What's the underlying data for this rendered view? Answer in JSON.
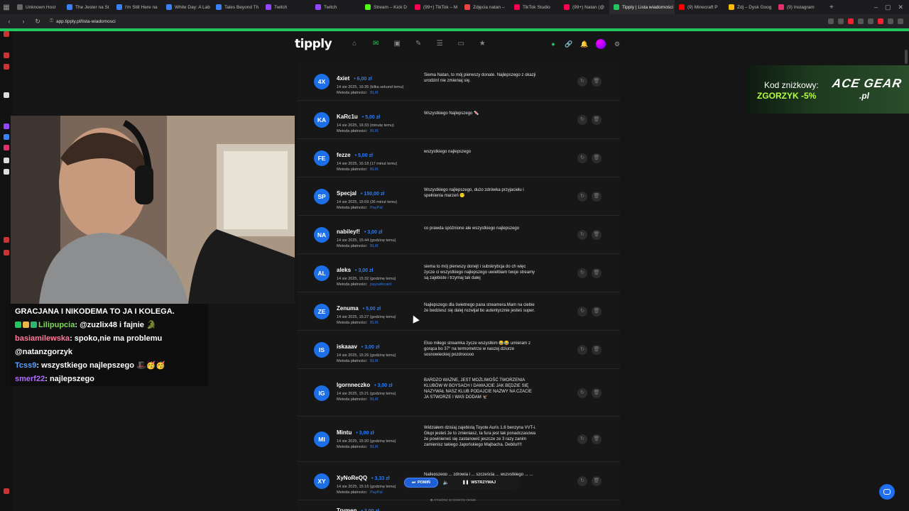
{
  "browser": {
    "tabs": [
      {
        "title": "Unknown Host",
        "color": "#666"
      },
      {
        "title": "The Jester na St",
        "color": "#3b82f6"
      },
      {
        "title": "I'm Still Here na",
        "color": "#3b82f6"
      },
      {
        "title": "White Day: A Lab",
        "color": "#3b82f6"
      },
      {
        "title": "Tales Beyond Th",
        "color": "#3b82f6"
      },
      {
        "title": "Twitch",
        "color": "#9146ff"
      },
      {
        "title": "Twitch",
        "color": "#9146ff"
      },
      {
        "title": "Stream – Kick D",
        "color": "#53fc18"
      },
      {
        "title": "(99+) TikTok – M",
        "color": "#ff0050"
      },
      {
        "title": "Zdjęcia natan –",
        "color": "#e44"
      },
      {
        "title": "TikTok Studio",
        "color": "#ff0050"
      },
      {
        "title": "(99+) Natan (@",
        "color": "#ff0050"
      },
      {
        "title": "Tipply | Lista wiadomości",
        "color": "#22c55e",
        "active": true
      },
      {
        "title": "(9) Minecraft P",
        "color": "#f00"
      },
      {
        "title": "Zdj – Dysk Goog",
        "color": "#fbbc04"
      },
      {
        "title": "(9) Instagram",
        "color": "#e1306c"
      }
    ],
    "new_tab": "+",
    "url": "app.tipply.pl/lista-wiadomosci"
  },
  "app": {
    "logo": "tipply",
    "nav": [
      {
        "icon": "home-icon",
        "glyph": "⌂"
      },
      {
        "icon": "messages-icon",
        "glyph": "✉",
        "active": true
      },
      {
        "icon": "wallet-icon",
        "glyph": "▣"
      },
      {
        "icon": "edit-icon",
        "glyph": "✎"
      },
      {
        "icon": "list-icon",
        "glyph": "☰"
      },
      {
        "icon": "calendar-icon",
        "glyph": "▭"
      },
      {
        "icon": "star-icon",
        "glyph": "★"
      }
    ]
  },
  "donations": [
    {
      "initials": "4X",
      "name": "4xiet",
      "amount": "6,00 zł",
      "date": "14 sie 2025, 16:35 (kilka sekund temu)",
      "method_label": "Metoda płatności:",
      "method": "BLIK",
      "message": "Siema Natan, to mój pierwszy donate. Najlepszego z okazji urodzin! nie zmieniaj się.",
      "h": 54
    },
    {
      "initials": "KA",
      "name": "KaRc1u",
      "amount": "5,00 zł",
      "date": "14 sie 2025, 16:33 (minutę temu)",
      "method_label": "Metoda płatności:",
      "method": "BLIK",
      "message": "Wszystkiego Najlepszego 🍬",
      "h": 54
    },
    {
      "initials": "FE",
      "name": "fezze",
      "amount": "5,00 zł",
      "date": "14 sie 2025, 16:18 (17 minut temu)",
      "method_label": "Metoda płatności:",
      "method": "BLIK",
      "message": "wszystkiego najlepszego",
      "h": 54
    },
    {
      "initials": "SP",
      "name": "Specjal",
      "amount": "150,00 zł",
      "date": "14 sie 2025, 15:59 (36 minut temu)",
      "method_label": "Metoda płatności:",
      "method": "PayPal",
      "message": "Wszystkiego najlepszego, dużo zdrówka przyjaciełu i spełnienia marzeń 😶",
      "h": 54
    },
    {
      "initials": "NA",
      "name": "nabileyf!",
      "amount": "3,00 zł",
      "date": "14 sie 2025, 15:44 (godzinę temu)",
      "method_label": "Metoda płatności:",
      "method": "BLIK",
      "message": "co prawda spóźnione ale wszystkiego najlepszego",
      "h": 54
    },
    {
      "initials": "AL",
      "name": "aleks",
      "amount": "3,00 zł",
      "date": "14 sie 2025, 15:32 (godzinę temu)",
      "method_label": "Metoda płatności:",
      "method": "paysafecard",
      "message": "siema to mój pierwszy donejt i subskrybcja do ch więc życze ci wszystkiego najlepszego uwielbiam twoje streamy są zajebiste i trzymaj tak dalej",
      "h": 54
    },
    {
      "initials": "ZE",
      "name": "Zenuma",
      "amount": "5,00 zł",
      "date": "14 sie 2025, 15:27 (godzinę temu)",
      "method_label": "Metoda płatności:",
      "method": "BLIK",
      "message": "Najlepszego dla świetnego pana streamera.Mam na ciebie że bedziesz się dalej rozwijał bo autentycznie jesteś super.",
      "h": 54
    },
    {
      "initials": "IS",
      "name": "iskaaav",
      "amount": "3,00 zł",
      "date": "14 sie 2025, 15:26 (godzinę temu)",
      "method_label": "Metoda płatności:",
      "method": "BLIK",
      "message": "Eloo miłego streamka życze wszystkim 😂😂 umieram z gorąca bo 37° na termometrze w naszej dziurze sosnowieckiej pozdrooooo",
      "h": 54
    },
    {
      "initials": "IG",
      "name": "Igornneczko",
      "amount": "3,00 zł",
      "date": "14 sie 2025, 15:21 (godzinę temu)",
      "method_label": "Metoda płatności:",
      "method": "BLIK",
      "message": "BARDZO WAŻNE, JEST MOŻLIWOŚĆ TWORZENIA KLUBÓW W BOYSACH I DAWAJCIE JAK BĘDZIE SIĘ NAZYWAŁ NASZ KLUB PODAJCIE NAZWY NA CZACIE JA STWORZE I WAS DODAM 🦅",
      "h": 67
    },
    {
      "initials": "MI",
      "name": "Mintu",
      "amount": "3,00 zł",
      "date": "14 sie 2025, 15:20 (godzinę temu)",
      "method_label": "Metoda płatności:",
      "method": "BLIK",
      "message": "Widziałem dzisiaj zajebistą Toyote Auris 1.6 benzyna VVT-i. Głupi jesteś że to zmieniasz, ta fura jest tak ponadczasowa że powinieneś się zastanowić jeszcze ze 3 razy zanim zamienisz takiego Japońskiego Majbacha. Debilu!!!!",
      "h": 64
    },
    {
      "initials": "XY",
      "name": "XyNoReQQ",
      "amount": "3,33 zł",
      "date": "14 sie 2025, 15:16 (godzinę temu)",
      "method_label": "Metoda płatności:",
      "method": "PayPal",
      "message": "Najlepszego ... zdrowia i ... szczęścia ... wszystkiego ... ... ... zmienia",
      "h": 54
    },
    {
      "initials": "",
      "name": "Trymen",
      "amount": "3,00 zł",
      "date": "",
      "method_label": "",
      "method": "",
      "message": "",
      "h": 20
    }
  ],
  "player": {
    "skip": "POMIŃ",
    "pause": "WSTRZYMAJ",
    "new_window": "OTWÓRZ W NOWYM OKNIE"
  },
  "chat": [
    {
      "user": "",
      "text": "GRACJANA I NIKODEMA TO JA I KOLEGA.",
      "cls": ""
    },
    {
      "user": "Lilipupcia",
      "text": "@zuzlix48 i fajnie 🐊",
      "cls": "u1"
    },
    {
      "user": "basiamilewska",
      "text": "spoko,nie ma problemu",
      "cls": "u2"
    },
    {
      "user": "",
      "text": "@natanzgorzyk",
      "cls": ""
    },
    {
      "user": "Tcss9",
      "text": "wszystkiego najlepszego 🎩🥳🥳",
      "cls": "u3"
    },
    {
      "user": "smerf22",
      "text": "najlepszego",
      "cls": "u4"
    }
  ],
  "ad": {
    "line1": "Kod zniżkowy:",
    "line2": "ZGORZYK -5%",
    "brand": "ACE GEAR",
    "brand_sub": ".pl"
  }
}
